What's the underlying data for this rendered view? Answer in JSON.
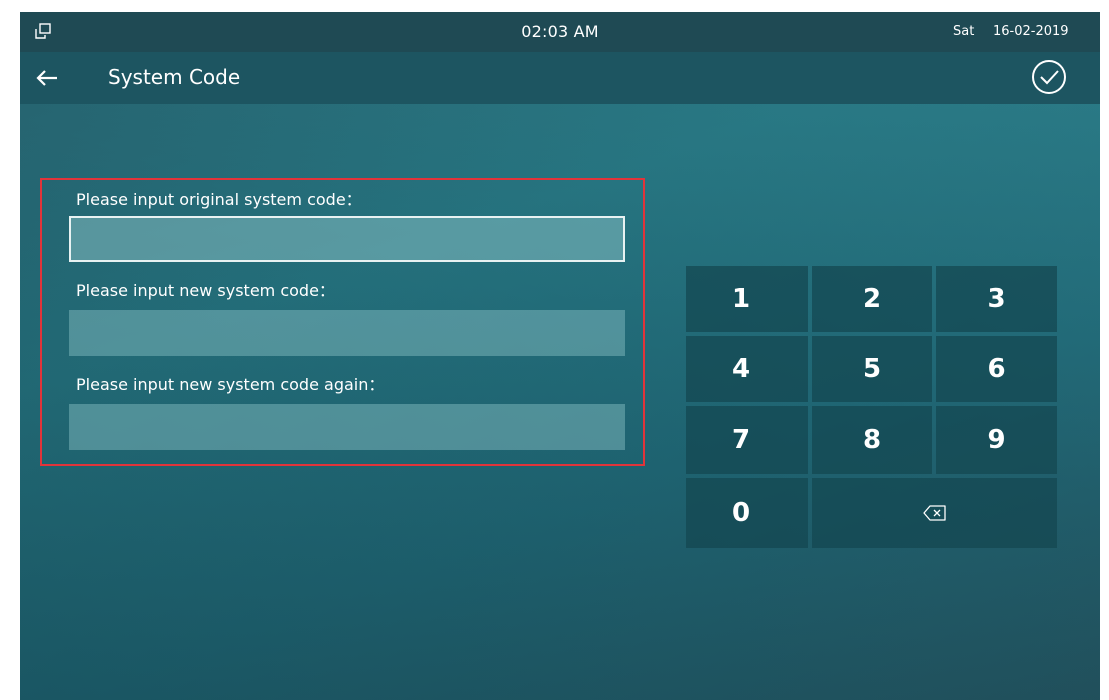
{
  "status_bar": {
    "time": "02:03 AM",
    "day": "Sat",
    "date": "16-02-2019",
    "left_icon": "window-icon"
  },
  "header": {
    "back_icon": "back-arrow-icon",
    "title": "System Code",
    "confirm_icon": "check-circle-icon"
  },
  "form": {
    "fields": [
      {
        "label": "Please input original system code：",
        "value": "",
        "focused": true
      },
      {
        "label": "Please input new system code：",
        "value": "",
        "focused": false
      },
      {
        "label": "Please input new system code again：",
        "value": "",
        "focused": false
      }
    ],
    "highlight_color": "#e2343a"
  },
  "keypad": {
    "keys": [
      "1",
      "2",
      "3",
      "4",
      "5",
      "6",
      "7",
      "8",
      "9",
      "0"
    ],
    "backspace_icon": "backspace-icon"
  },
  "colors": {
    "status_bar": "#1f4a54",
    "title_bar": "#1d5561",
    "key_background": "#1d5560",
    "input_background": "#5f9aa0"
  }
}
